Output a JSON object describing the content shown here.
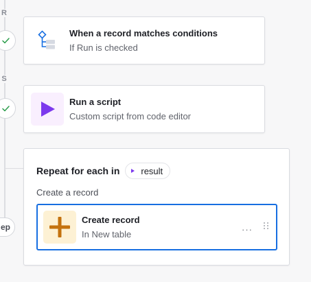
{
  "rail": {
    "top_letter": "R",
    "middle_letter": "S",
    "pill_label": "ep"
  },
  "trigger": {
    "title": "When a record matches conditions",
    "subtitle": "If Run is checked",
    "icon": "flowchart-icon"
  },
  "script_step": {
    "title": "Run a script",
    "subtitle": "Custom script from code editor",
    "icon": "play-icon"
  },
  "repeat": {
    "title": "Repeat for each in",
    "token_label": "result",
    "sub_label": "Create a record",
    "create": {
      "title": "Create record",
      "subtitle": "In New table",
      "more": "···",
      "icon": "plus-icon"
    }
  },
  "colors": {
    "accent_blue": "#166ee1",
    "script_purple": "#7c39ed",
    "create_orange": "#c4720e",
    "check_green": "#2a9c4a"
  }
}
